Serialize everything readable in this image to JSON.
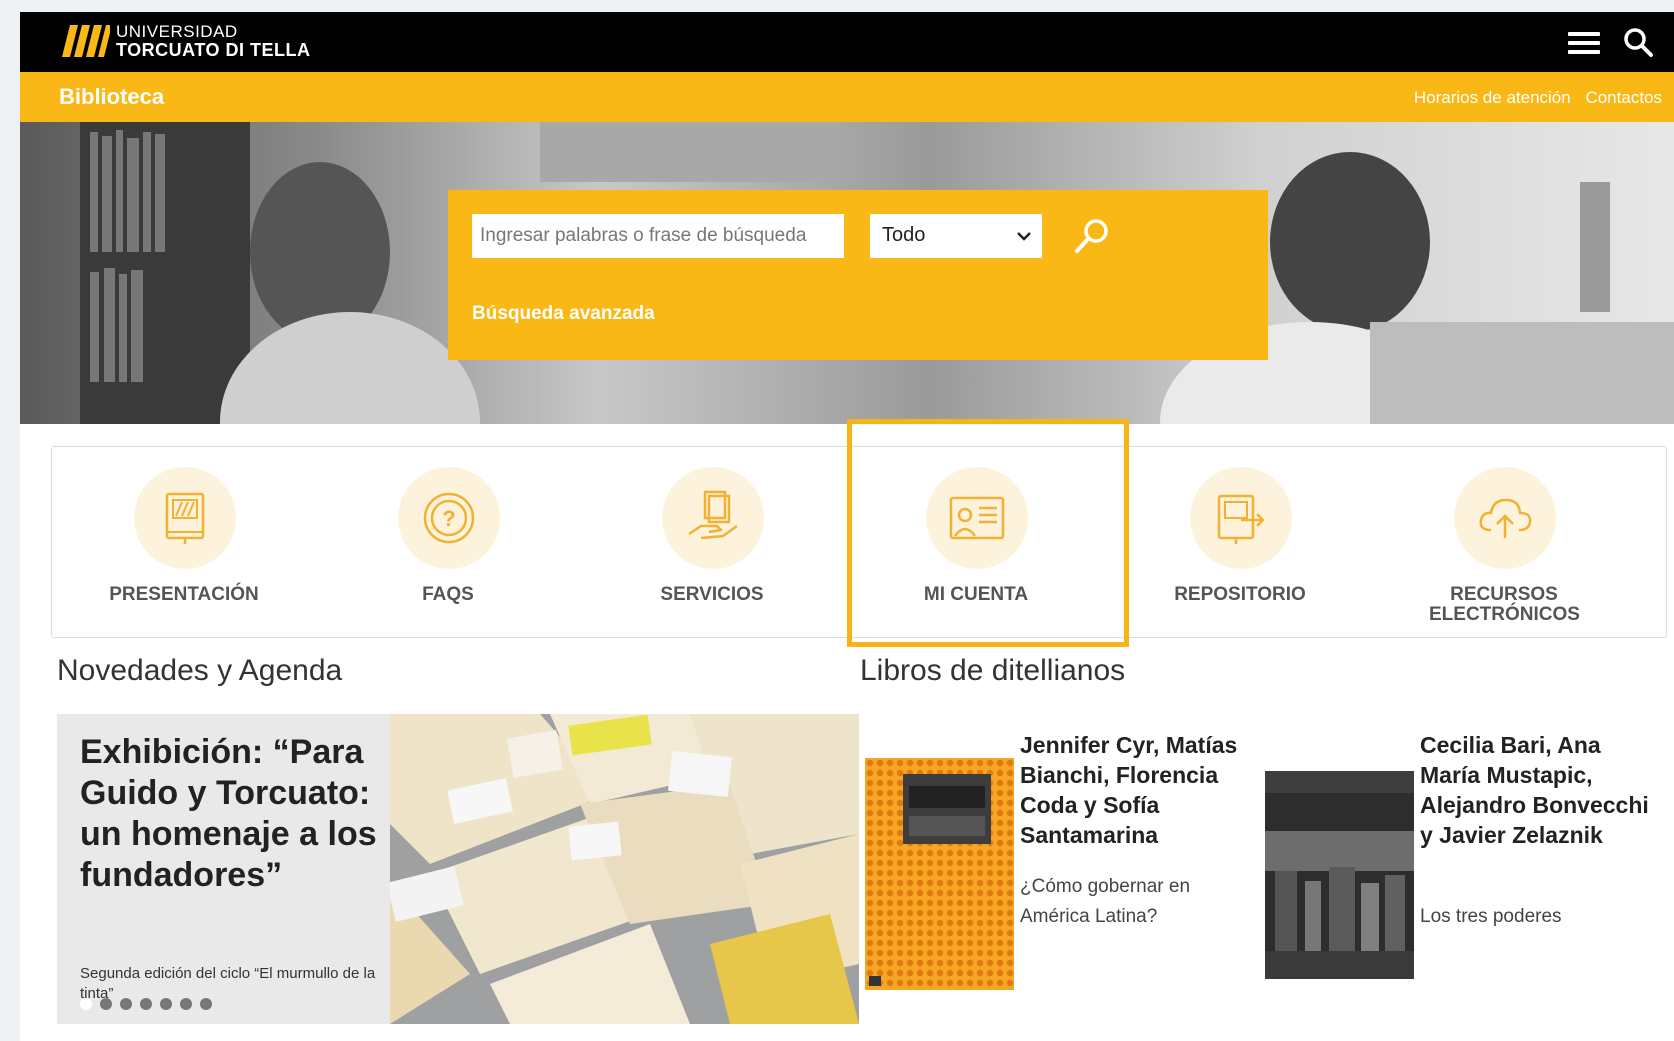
{
  "header": {
    "logo_line1": "UNIVERSIDAD",
    "logo_line2": "TORCUATO DI TELLA"
  },
  "subheader": {
    "title": "Biblioteca",
    "links": [
      "Horarios de atención",
      "Contactos"
    ]
  },
  "search": {
    "placeholder": "Ingresar palabras o frase de búsqueda",
    "scope_selected": "Todo",
    "advanced_label": "Búsqueda avanzada"
  },
  "quick_links": [
    {
      "label": "PRESENTACIÓN",
      "icon": "book-icon"
    },
    {
      "label": "FAQS",
      "icon": "question-icon"
    },
    {
      "label": "SERVICIOS",
      "icon": "hand-books-icon"
    },
    {
      "label": "MI CUENTA",
      "icon": "id-card-icon"
    },
    {
      "label": "REPOSITORIO",
      "icon": "repository-export-icon"
    },
    {
      "label": "RECURSOS ELECTRÓNICOS",
      "icon": "cloud-upload-icon"
    }
  ],
  "news": {
    "section_title": "Novedades y Agenda",
    "title": "Exhibición: “Para Guido y Torcuato: un homenaje a los fundadores”",
    "subtitle": "Segunda edición del ciclo “El murmullo de la tinta”"
  },
  "books": {
    "section_title": "Libros de ditellianos",
    "items": [
      {
        "authors": "Jennifer Cyr, Matías Bianchi, Florencia Coda y Sofía Santamarina",
        "title": "¿Cómo gobernar en América Latina?"
      },
      {
        "authors": "Cecilia Bari, Ana María Mustapic, Alejandro Bonvecchi y Javier Zelaznik",
        "title": "Los tres poderes"
      }
    ]
  },
  "colors": {
    "brand_yellow": "#f9b816",
    "topbar": "#000000",
    "highlight": "#f7b31a"
  }
}
